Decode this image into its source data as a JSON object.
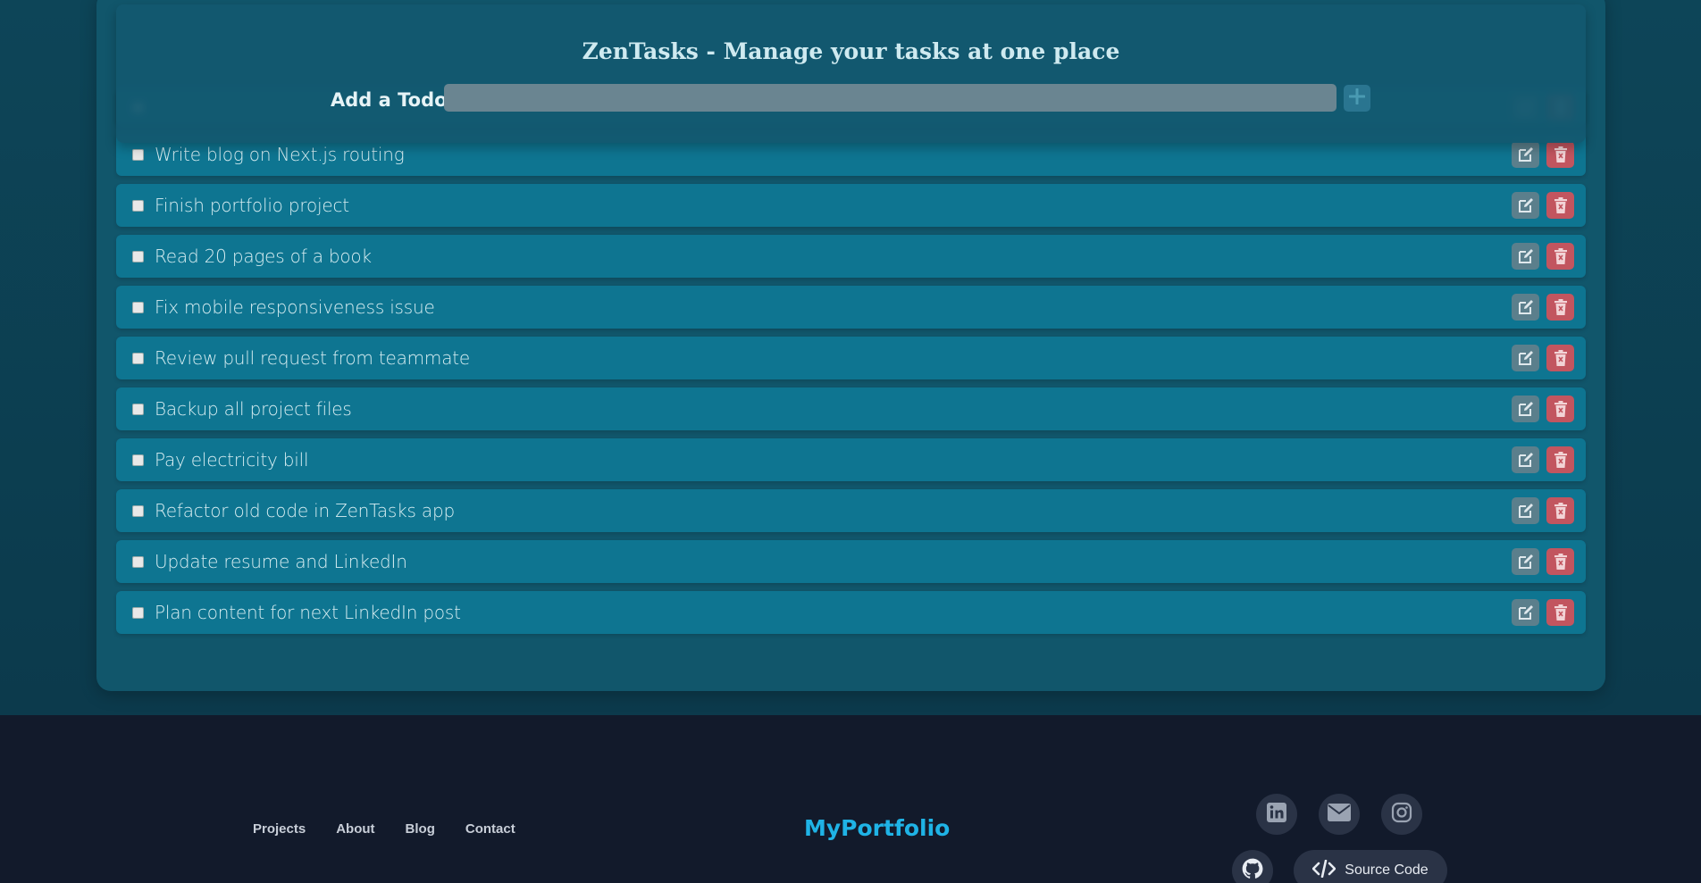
{
  "header": {
    "title": "ZenTasks - Manage your tasks at one place",
    "add_label": "Add a Todo",
    "input_value": "",
    "input_placeholder": "",
    "add_icon": "plus-icon"
  },
  "todos": [
    {
      "text": "",
      "checked": false
    },
    {
      "text": "Write blog on Next.js routing",
      "checked": false
    },
    {
      "text": "Finish portfolio project",
      "checked": false
    },
    {
      "text": "Read 20 pages of a book",
      "checked": false
    },
    {
      "text": "Fix mobile responsiveness issue",
      "checked": false
    },
    {
      "text": "Review pull request from teammate",
      "checked": false
    },
    {
      "text": "Backup all project files",
      "checked": false
    },
    {
      "text": "Pay electricity bill",
      "checked": false
    },
    {
      "text": "Refactor old code in ZenTasks app",
      "checked": false
    },
    {
      "text": "Update resume and LinkedIn",
      "checked": false
    },
    {
      "text": "Plan content for next LinkedIn post",
      "checked": false
    }
  ],
  "item_actions": {
    "edit_icon": "edit-icon",
    "delete_icon": "trash-icon"
  },
  "footer": {
    "nav": [
      "Projects",
      "About",
      "Blog",
      "Contact"
    ],
    "brand": "MyPortfolio",
    "social_icons": [
      "linkedin-icon",
      "mail-icon",
      "instagram-icon",
      "github-icon"
    ],
    "source_label": "Source Code",
    "source_icon": "code-icon"
  },
  "colors": {
    "background": "#0b3d4f",
    "card": "#11566b",
    "todo_item": "#0e7591",
    "edit_button": "#5b7f8c",
    "delete_button": "#c2555f",
    "footer": "#121a2b",
    "brand": "#1fb3e6"
  }
}
